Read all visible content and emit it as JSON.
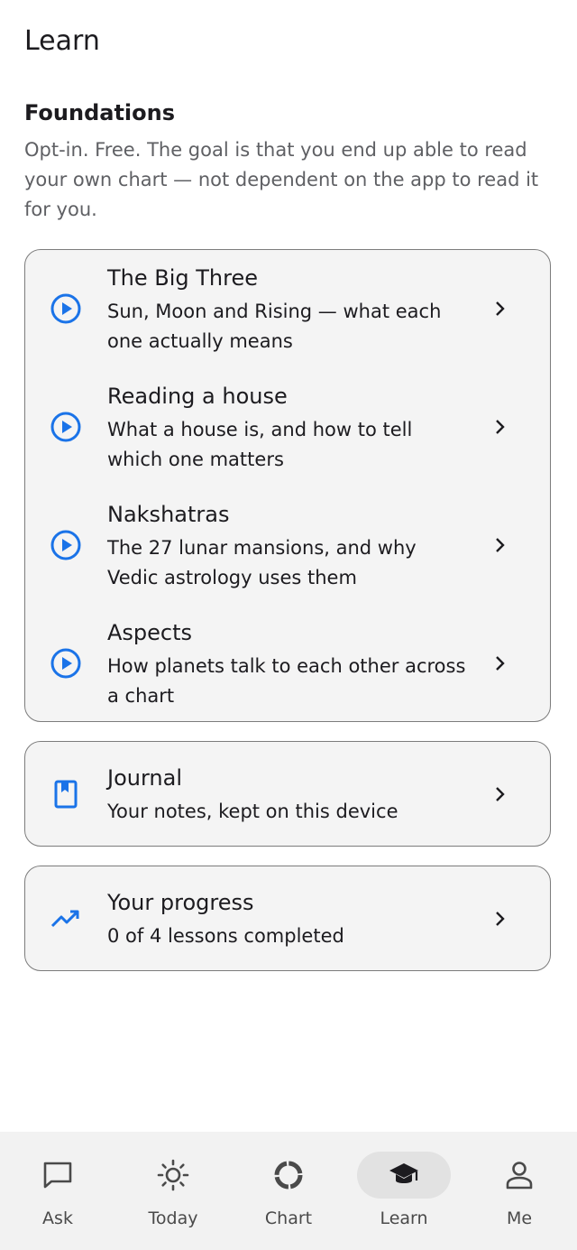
{
  "header": {
    "title": "Learn"
  },
  "section": {
    "title": "Foundations",
    "description": "Opt-in. Free. The goal is that you end up able to read your own chart — not dependent on the app to read it for you."
  },
  "lessons": [
    {
      "title": "The Big Three",
      "subtitle": "Sun, Moon and Rising — what each one actually means",
      "icon": "play-circle-icon"
    },
    {
      "title": "Reading a house",
      "subtitle": "What a house is, and how to tell which one matters",
      "icon": "play-circle-icon"
    },
    {
      "title": "Nakshatras",
      "subtitle": "The 27 lunar mansions, and why Vedic astrology uses them",
      "icon": "play-circle-icon"
    },
    {
      "title": "Aspects",
      "subtitle": "How planets talk to each other across a chart",
      "icon": "play-circle-icon"
    }
  ],
  "journal": {
    "title": "Journal",
    "subtitle": "Your notes, kept on this device",
    "icon": "bookmark-book-icon"
  },
  "progress": {
    "title": "Your progress",
    "subtitle": "0 of 4 lessons completed",
    "icon": "trending-up-icon"
  },
  "nav": {
    "items": [
      {
        "label": "Ask",
        "icon": "chat-bubble-icon"
      },
      {
        "label": "Today",
        "icon": "sun-icon"
      },
      {
        "label": "Chart",
        "icon": "chart-ring-icon"
      },
      {
        "label": "Learn",
        "icon": "graduation-cap-icon",
        "active": true
      },
      {
        "label": "Me",
        "icon": "person-icon"
      }
    ]
  },
  "colors": {
    "accent": "#1a73e8",
    "card_bg": "#f4f4f4",
    "card_border": "#7c7c7c",
    "nav_bg": "#f2f2f2",
    "nav_active_pill": "#e2e2e2"
  }
}
